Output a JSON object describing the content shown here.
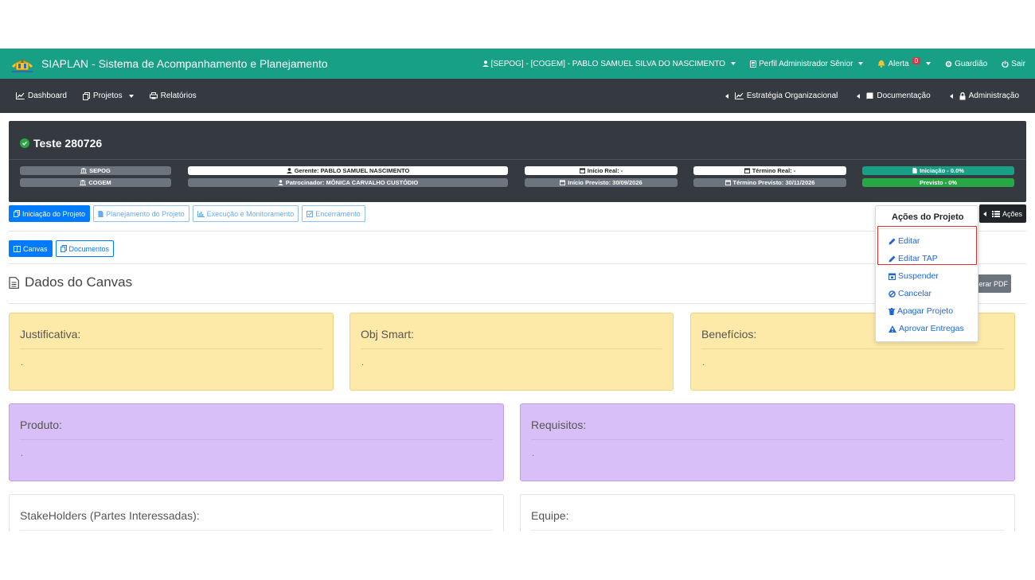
{
  "header": {
    "app_title": "SIAPLAN - Sistema de Acompanhamento e Planejamento",
    "user": "[SEPOG] - [COGEM] - PABLO SAMUEL SILVA DO NASCIMENTO",
    "profile": "Perfil Administrador Sênior",
    "alert_label": "Alerta",
    "alert_count": "0",
    "guardiao": "Guardião",
    "logout": "Sair",
    "accent": "#17a085"
  },
  "nav": {
    "dashboard": "Dashboard",
    "projetos": "Projetos",
    "relatorios": "Relatórios",
    "estrategia": "Estratégia Organizacional",
    "documentacao": "Documentação",
    "administracao": "Administração"
  },
  "project": {
    "title": "Teste 280726",
    "unit1": "SEPOG",
    "unit2": "COGEM",
    "gerente": "Gerente: PABLO SAMUEL NASCIMENTO",
    "patrocinador": "Patrocinador: MÔNICA CARVALHO CUSTÓDIO",
    "inicio_real": "Início Real: -",
    "inicio_previsto": "Início Previsto: 30/09/2026",
    "termino_real": "Término Real: -",
    "termino_previsto": "Término Previsto: 30/11/2026",
    "status_iniciacao": "Iniciação - 0.0%",
    "status_previsto": "Previsto - 0%"
  },
  "phases": [
    "Iniciação do Projeto",
    "Planejamento do Projeto",
    "Execução e Monitoramento",
    "Encerramento"
  ],
  "subtabs": [
    "Canvas",
    "Documentos"
  ],
  "acoes_button": "Ações",
  "canvas": {
    "title": "Dados do Canvas",
    "pdf_button": "erar PDF"
  },
  "cards": {
    "justificativa": {
      "title": "Justificativa:",
      "value": "."
    },
    "obj_smart": {
      "title": "Obj Smart:",
      "value": "."
    },
    "beneficios": {
      "title": "Benefícios:",
      "value": "."
    },
    "produto": {
      "title": "Produto:",
      "value": "."
    },
    "requisitos": {
      "title": "Requisitos:",
      "value": "."
    },
    "stakeholders": {
      "title": "StakeHolders (Partes Interessadas):"
    },
    "equipe": {
      "title": "Equipe:"
    }
  },
  "dropdown": {
    "header": "Ações do Projeto",
    "items": [
      "Editar",
      "Editar TAP",
      "Suspender",
      "Cancelar",
      "Apagar Projeto",
      "Aprovar Entregas"
    ]
  }
}
